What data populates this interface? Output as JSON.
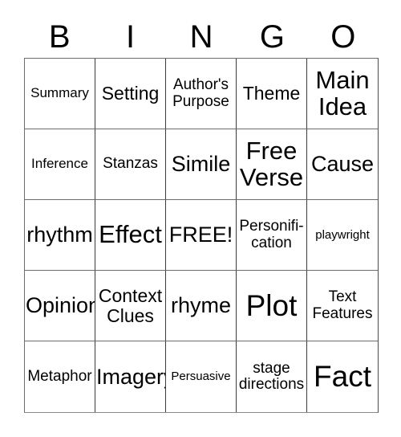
{
  "card": {
    "title": "BINGO",
    "header_letters": [
      "B",
      "I",
      "N",
      "G",
      "O"
    ],
    "free_space_label": "FREE!",
    "rows": [
      [
        {
          "label": "Summary",
          "size": "t-sm"
        },
        {
          "label": "Setting",
          "size": "t-lg"
        },
        {
          "label": "Author's\nPurpose",
          "size": "t-md"
        },
        {
          "label": "Theme",
          "size": "t-lg"
        },
        {
          "label": "Main\nIdea",
          "size": "t-xxl"
        }
      ],
      [
        {
          "label": "Inference",
          "size": "t-sm"
        },
        {
          "label": "Stanzas",
          "size": "t-md"
        },
        {
          "label": "Simile",
          "size": "t-xl"
        },
        {
          "label": "Free\nVerse",
          "size": "t-xxl"
        },
        {
          "label": "Cause",
          "size": "t-xl"
        }
      ],
      [
        {
          "label": "rhythm",
          "size": "t-xl"
        },
        {
          "label": "Effect",
          "size": "t-xxl"
        },
        {
          "label": "FREE!",
          "size": "t-xl"
        },
        {
          "label": "Personifi-\ncation",
          "size": "t-md"
        },
        {
          "label": "playwright",
          "size": "t-xs"
        }
      ],
      [
        {
          "label": "Opinion",
          "size": "t-xl"
        },
        {
          "label": "Context\nClues",
          "size": "t-lg"
        },
        {
          "label": "rhyme",
          "size": "t-xl"
        },
        {
          "label": "Plot",
          "size": "t-huge"
        },
        {
          "label": "Text\nFeatures",
          "size": "t-md"
        }
      ],
      [
        {
          "label": "Metaphor",
          "size": "t-md"
        },
        {
          "label": "Imagery",
          "size": "t-xl"
        },
        {
          "label": "Persuasive",
          "size": "t-xs"
        },
        {
          "label": "stage\ndirections",
          "size": "t-md"
        },
        {
          "label": "Fact",
          "size": "t-huge"
        }
      ]
    ]
  },
  "colors": {
    "background": "#ffffff",
    "text": "#000000",
    "grid_line": "#3d3d3d",
    "grid_line_light": "#6d6d6d"
  }
}
